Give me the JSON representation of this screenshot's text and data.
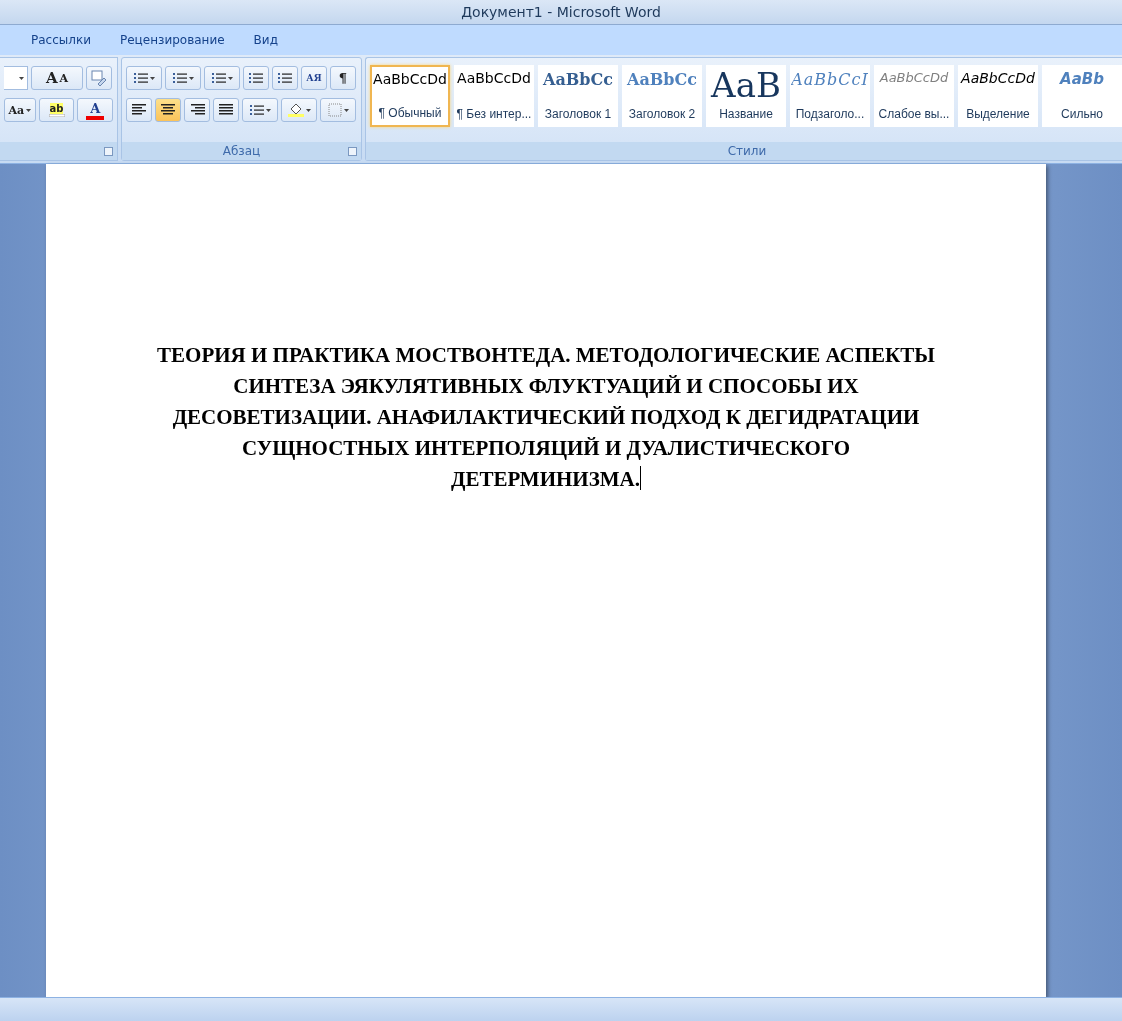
{
  "window": {
    "title": "Документ1 - Microsoft Word"
  },
  "tabs": [
    {
      "label": "Рассылки",
      "selected": false
    },
    {
      "label": "Рецензирование",
      "selected": false
    },
    {
      "label": "Вид",
      "selected": false
    }
  ],
  "font_group": {
    "grow_glyph": "A",
    "shrink_glyph": "A",
    "case_glyph": "Aa",
    "highlight_glyph": "ab",
    "color_glyph": "A"
  },
  "paragraph_group": {
    "label": "Абзац",
    "sort_glyph": "АЯ",
    "pilcrow": "¶",
    "alignment": [
      {
        "kind": "left",
        "selected": false
      },
      {
        "kind": "center",
        "selected": true
      },
      {
        "kind": "right",
        "selected": false
      },
      {
        "kind": "justify",
        "selected": false
      }
    ]
  },
  "styles_group": {
    "label": "Стили",
    "styles": [
      {
        "kind": "normal",
        "sample": "AaBbCcDd",
        "label": "¶ Обычный",
        "selected": true
      },
      {
        "kind": "normal",
        "sample": "AaBbCcDd",
        "label": "¶ Без интер...",
        "selected": false
      },
      {
        "kind": "heading1",
        "sample": "AaBbCc",
        "label": "Заголовок 1",
        "selected": false
      },
      {
        "kind": "heading2",
        "sample": "AaBbCc",
        "label": "Заголовок 2",
        "selected": false
      },
      {
        "kind": "title",
        "sample": "AaB",
        "label": "Название",
        "selected": false
      },
      {
        "kind": "subtitle",
        "sample": "AaBbCcI",
        "label": "Подзаголо...",
        "selected": false
      },
      {
        "kind": "subtle",
        "sample": "AaBbCcDd",
        "label": "Слабое вы...",
        "selected": false
      },
      {
        "kind": "emphasis",
        "sample": "AaBbCcDd",
        "label": "Выделение",
        "selected": false
      },
      {
        "kind": "strong",
        "sample": "AaBb",
        "label": "Сильно",
        "selected": false
      }
    ]
  },
  "document": {
    "text": "ТЕОРИЯ И ПРАКТИКА МОСТВОНТЕДА. МЕТОДОЛОГИЧЕСКИЕ АСПЕКТЫ СИНТЕЗА ЭЯКУЛЯТИВНЫХ ФЛУКТУАЦИЙ И СПОСОБЫ ИХ ДЕСОВЕТИЗАЦИИ. АНАФИЛАКТИЧЕСКИЙ ПОДХОД К ДЕГИДРАТАЦИИ СУЩНОСТНЫХ ИНТЕРПОЛЯЦИЙ И ДУАЛИСТИЧЕСКОГО ДЕТЕРМИНИЗМА."
  }
}
